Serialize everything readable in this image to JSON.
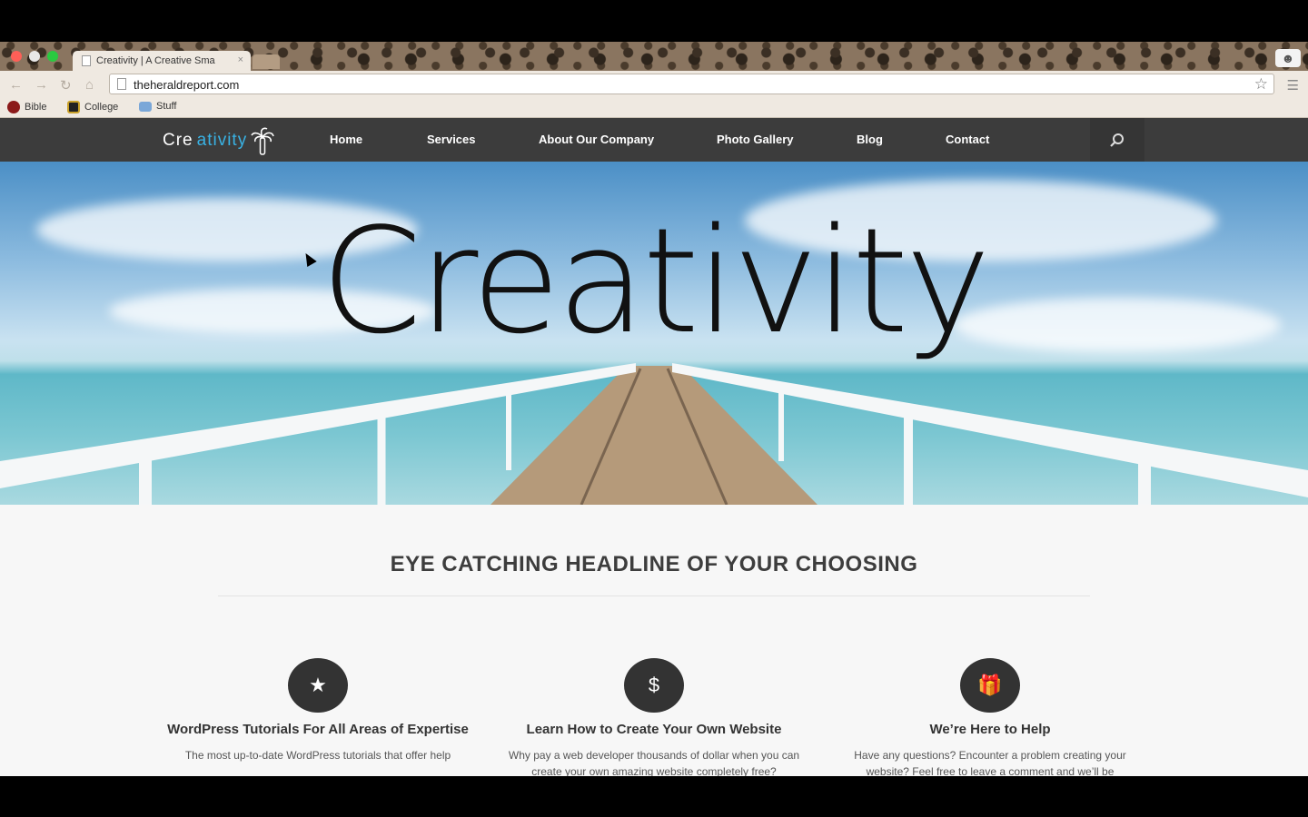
{
  "browser": {
    "tab_title": "Creativity | A Creative Sma",
    "tab_close": "×",
    "url": "theheraldreport.com",
    "bookmarks": [
      {
        "label": "Bible",
        "color": "#8b1a1a"
      },
      {
        "label": "College",
        "color": "#c9a12a"
      },
      {
        "label": "Stuff",
        "color": "#7aa7d8"
      }
    ]
  },
  "site": {
    "logo_start": "Cre",
    "logo_accent": "ativity",
    "nav": [
      "Home",
      "Services",
      "About Our Company",
      "Photo Gallery",
      "Blog",
      "Contact"
    ],
    "hero_title": "Creativity",
    "headline": "EYE CATCHING HEADLINE OF YOUR CHOOSING",
    "features": [
      {
        "icon": "star-icon",
        "title": "WordPress Tutorials For All Areas of Expertise",
        "text": "The most up-to-date WordPress tutorials that offer help"
      },
      {
        "icon": "dollar-icon",
        "title": "Learn How to Create Your Own Website",
        "text": "Why pay a web developer thousands of dollar when you can create your own amazing website completely free?"
      },
      {
        "icon": "gift-icon",
        "title": "We’re Here to Help",
        "text": "Have any questions? Encounter a problem creating your website? Feel free to leave a comment and we’ll be"
      }
    ]
  },
  "colors": {
    "nav_bg": "#3c3c3c",
    "accent": "#39b2e4",
    "icon_circle": "#333333"
  }
}
